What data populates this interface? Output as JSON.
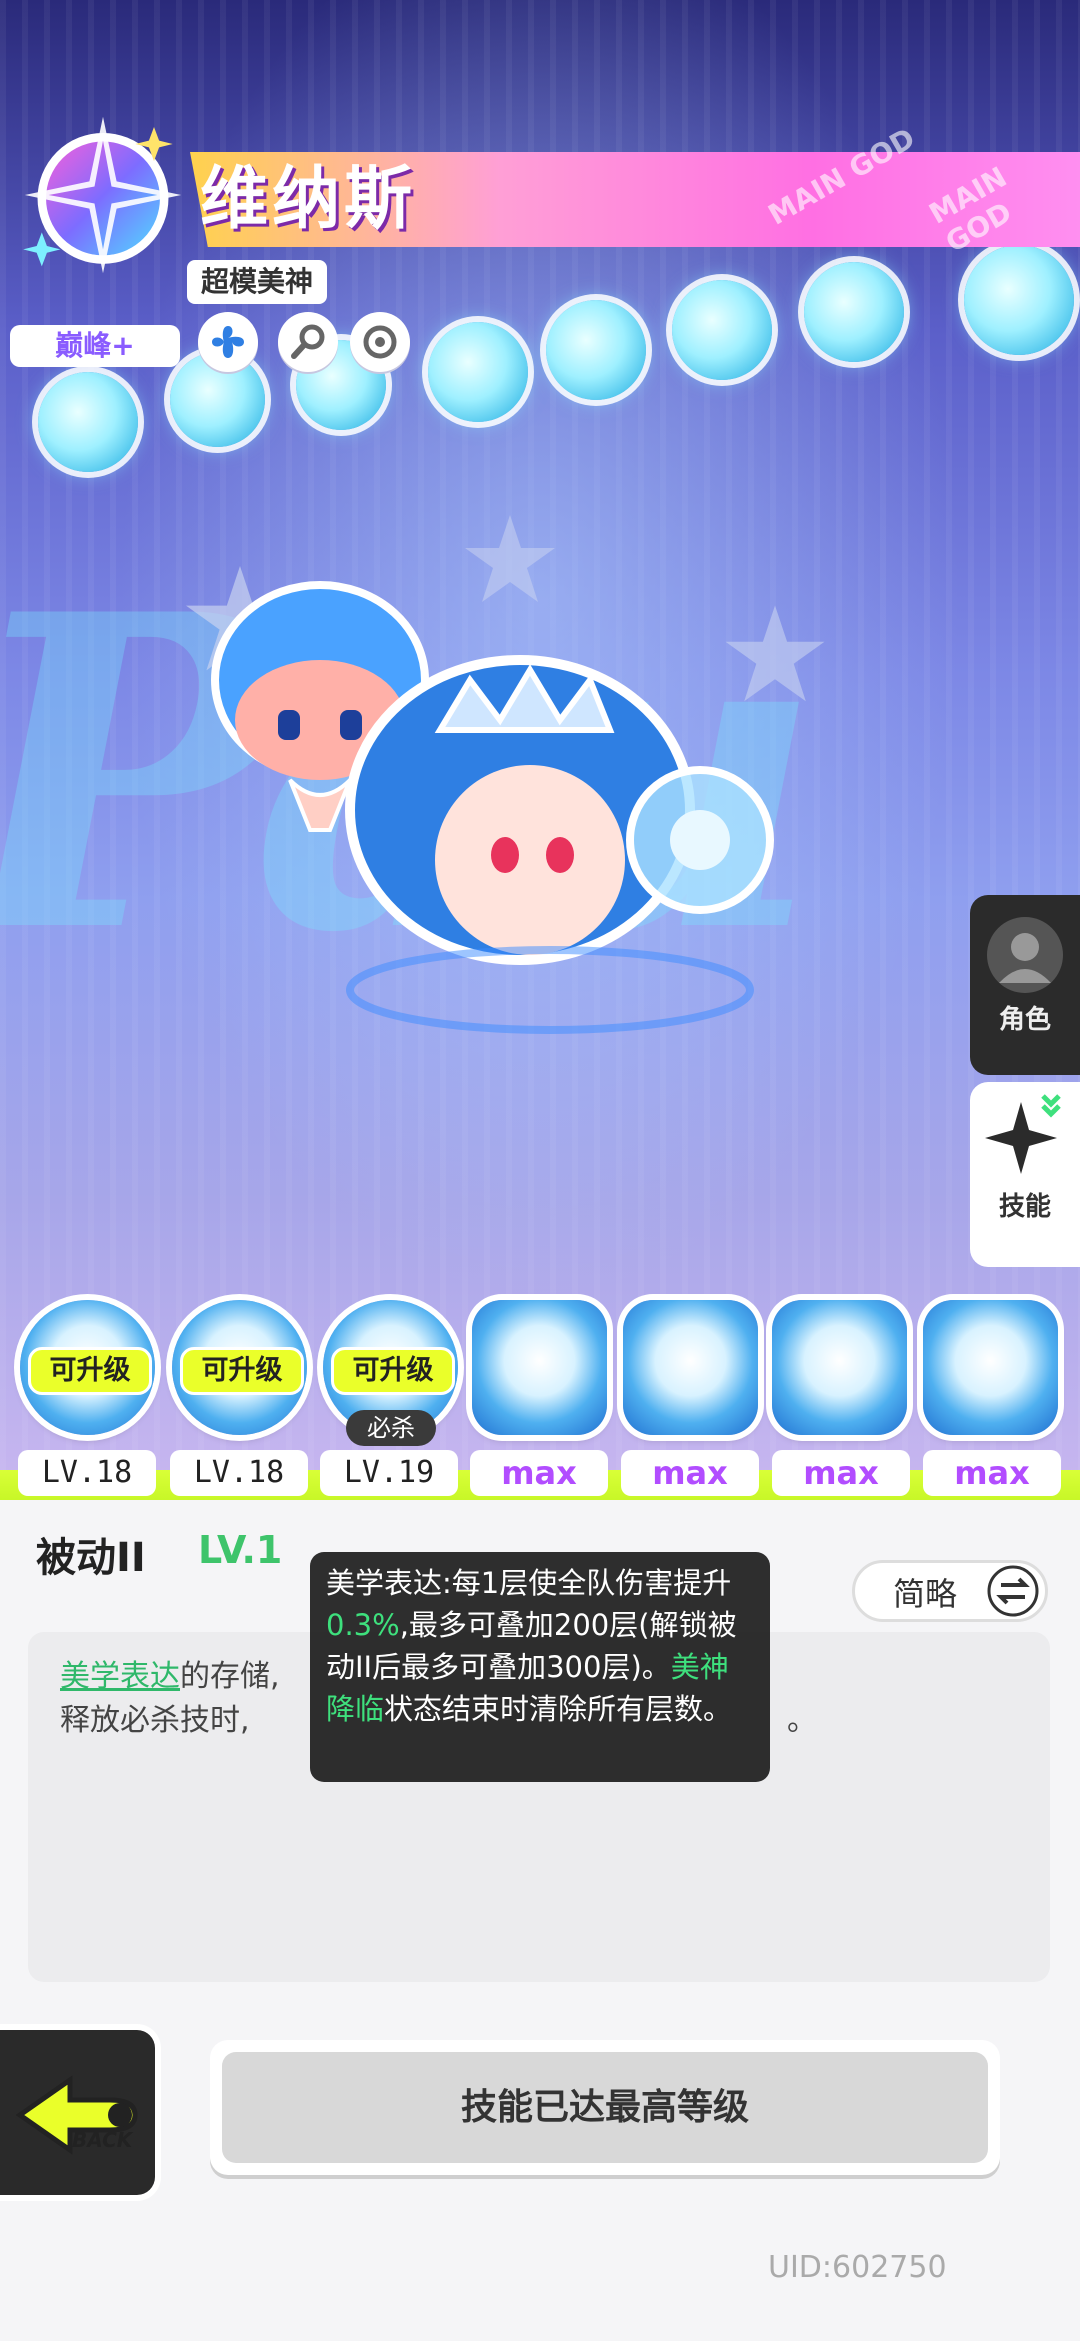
{
  "character": {
    "name": "维纳斯",
    "title": "超模美神",
    "rank": "巅峰+",
    "banner_text": "MAIN GOD"
  },
  "side_tabs": [
    {
      "label": "角色",
      "icon": "character-avatar-icon"
    },
    {
      "label": "技能",
      "icon": "skill-star-icon"
    }
  ],
  "skills": [
    {
      "badge": "可升级",
      "level": "LV.18"
    },
    {
      "badge": "可升级",
      "level": "LV.18"
    },
    {
      "badge": "可升级",
      "level": "LV.19",
      "tag": "必杀"
    },
    {
      "level": "max"
    },
    {
      "level": "max"
    },
    {
      "level": "max"
    },
    {
      "level": "max"
    }
  ],
  "detail": {
    "title": "被动II",
    "level": "LV.1",
    "toggle_label": "简略",
    "description_line1_prefix": "美学表达",
    "description_line1_rest": "的存储,",
    "description_line2": "释放必杀技时,",
    "description_line2_end": "。"
  },
  "tooltip": {
    "part1": "美学表达:每1层使全队伤害提升",
    "value": "0.3%",
    "part2": ",最多可叠加200层(解锁被动II后最多可叠加300层)。",
    "keyword": "美神降临",
    "part3": "状态结束时清除所有层数。"
  },
  "actions": {
    "back_label": "BACK",
    "main_button": "技能已达最高等级"
  },
  "footer": {
    "uid": "UID:602750"
  }
}
